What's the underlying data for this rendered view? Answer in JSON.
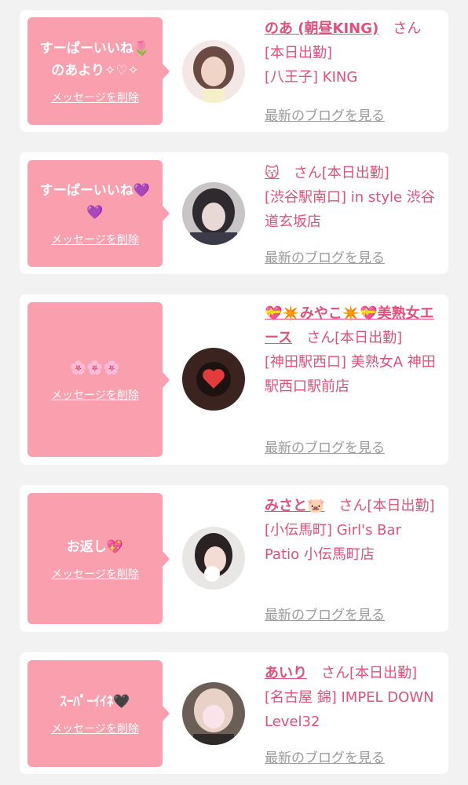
{
  "common": {
    "delete_label": "メッセージを削除",
    "blog_label": "最新のブログを見る",
    "honorific": "さん"
  },
  "notifications": [
    {
      "message": "すーぱーいいね🌷\nのあより✧♡✧",
      "name": "のあ (朝昼KING)",
      "shift": "[本日出勤]",
      "store": "[八王子] KING",
      "avatar_colors": [
        "#f4e8e6",
        "#6b4a44",
        "#f0d4c8"
      ]
    },
    {
      "message": "すーぱーいいね💜\n💜",
      "name": "😽",
      "shift": "[本日出勤]",
      "store": "[渋谷駅南口] in style 渋谷道玄坂店",
      "avatar_colors": [
        "#c9c4c6",
        "#2f2a2e",
        "#e8d8d6"
      ]
    },
    {
      "message": "🌸🌸🌸",
      "name": "💝✴️みやこ✴️💝美熟女エース",
      "shift": "[本日出勤]",
      "store": "[神田駅西口] 美熟女A 神田駅西口駅前店",
      "avatar_colors": [
        "#3b2420",
        "#1c1210",
        "#e23b3b"
      ]
    },
    {
      "message": "お返し💖",
      "name": "みさと🐷",
      "shift": "[本日出勤]",
      "store": "[小伝馬町] Girl's Bar Patio 小伝馬町店",
      "avatar_colors": [
        "#e9e6e6",
        "#2a2222",
        "#ffffff"
      ]
    },
    {
      "message": "ｽｰﾊﾟｰｲｲﾈ🖤",
      "name": "あいり",
      "shift": "[本日出勤]",
      "store": "[名古屋 錦] IMPEL DOWN Level32",
      "avatar_colors": [
        "#6b5e57",
        "#e8d2c8",
        "#fbe3ea"
      ]
    }
  ]
}
